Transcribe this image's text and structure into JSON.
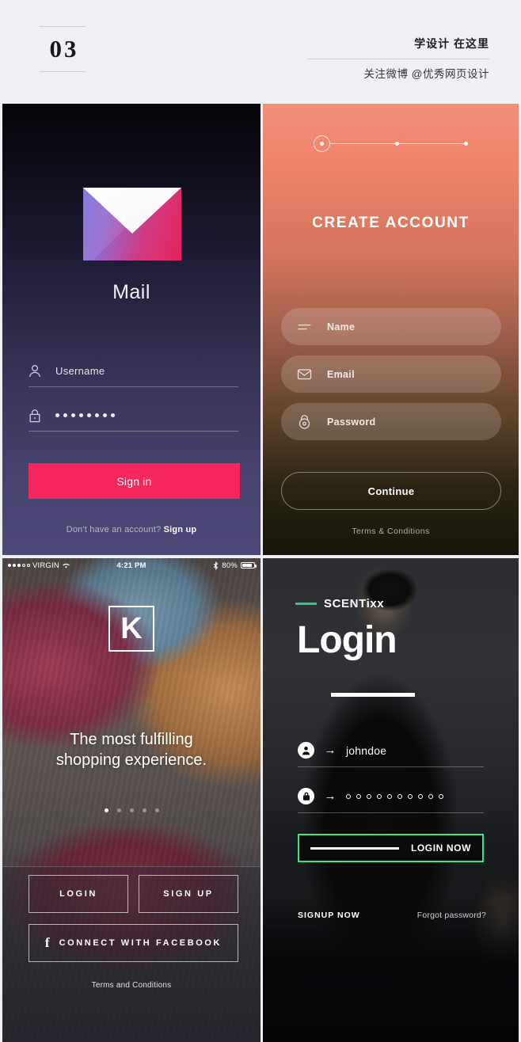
{
  "header": {
    "number": "03",
    "slogan": "学设计 在这里",
    "weibo": "关注微博 @优秀网页设计"
  },
  "screens": {
    "mail_login": {
      "app_name": "Mail",
      "icon": "envelope-icon",
      "username_field": {
        "icon": "user-icon",
        "value": "Username"
      },
      "password_field": {
        "icon": "lock-icon",
        "masked_dots": 8
      },
      "signin_button": "Sign in",
      "footer_text": "Don't have an account?",
      "footer_link": "Sign up",
      "accent_color": "#f5265c"
    },
    "create_account": {
      "title": "CREATE ACCOUNT",
      "steps_total": 3,
      "step_active": 1,
      "fields": [
        {
          "icon": "lines-icon",
          "label": "Name"
        },
        {
          "icon": "envelope-icon",
          "label": "Email"
        },
        {
          "icon": "lock-icon",
          "label": "Password"
        }
      ],
      "continue_button": "Continue",
      "terms_link": "Terms & Conditions",
      "accent_color": "#f3907a"
    },
    "shopping": {
      "statusbar": {
        "carrier": "VIRGIN",
        "time": "4:21 PM",
        "battery_percent": "80%",
        "wifi_icon": "wifi-icon",
        "bluetooth_icon": "bluetooth-icon",
        "battery_icon": "battery-icon"
      },
      "logo": "K",
      "tagline_line1": "The most fulfilling",
      "tagline_line2": "shopping experience.",
      "page_dots_total": 5,
      "page_dot_active": 1,
      "login_button": "LOGIN",
      "signup_button": "SIGN UP",
      "facebook_button": "CONNECT WITH FACEBOOK",
      "facebook_icon": "facebook-f-icon",
      "terms_link": "Terms and Conditions"
    },
    "scentixx": {
      "brand": "SCENTixx",
      "brand_accent": "#26d07c",
      "title": "Login",
      "username_field": {
        "icon": "user-circle-icon",
        "arrow": "→",
        "value": "johndoe"
      },
      "password_field": {
        "icon": "lock-circle-icon",
        "arrow": "→",
        "masked_dots": 10
      },
      "login_button": "LOGIN NOW",
      "login_button_border": "#2ee88a",
      "signup_link": "SIGNUP NOW",
      "forgot_link": "Forgot password?"
    }
  }
}
